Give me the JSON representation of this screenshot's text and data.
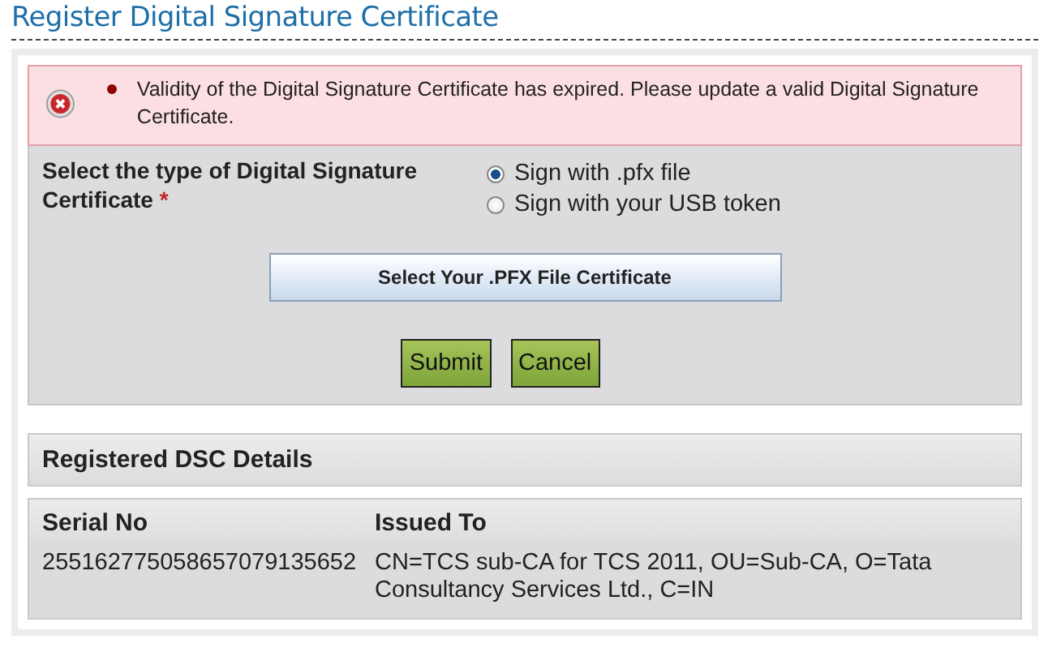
{
  "title": "Register Digital Signature Certificate",
  "error": {
    "messages": [
      "Validity of the Digital Signature Certificate has expired. Please update a valid Digital Signature Certificate."
    ]
  },
  "form": {
    "label": "Select the type of Digital Signature Certificate",
    "required_mark": "*",
    "options": [
      {
        "label": "Sign with .pfx file",
        "selected": true
      },
      {
        "label": "Sign with your USB token",
        "selected": false
      }
    ],
    "file_button": "Select Your .PFX File Certificate",
    "buttons": [
      "Submit",
      "Cancel"
    ]
  },
  "details": {
    "heading": "Registered DSC Details",
    "columns": [
      "Serial No",
      "Issued To"
    ],
    "rows": [
      [
        "255162775058657079135652",
        "CN=TCS sub-CA for TCS 2011, OU=Sub-CA, O=Tata Consultancy Services Ltd., C=IN"
      ]
    ]
  }
}
